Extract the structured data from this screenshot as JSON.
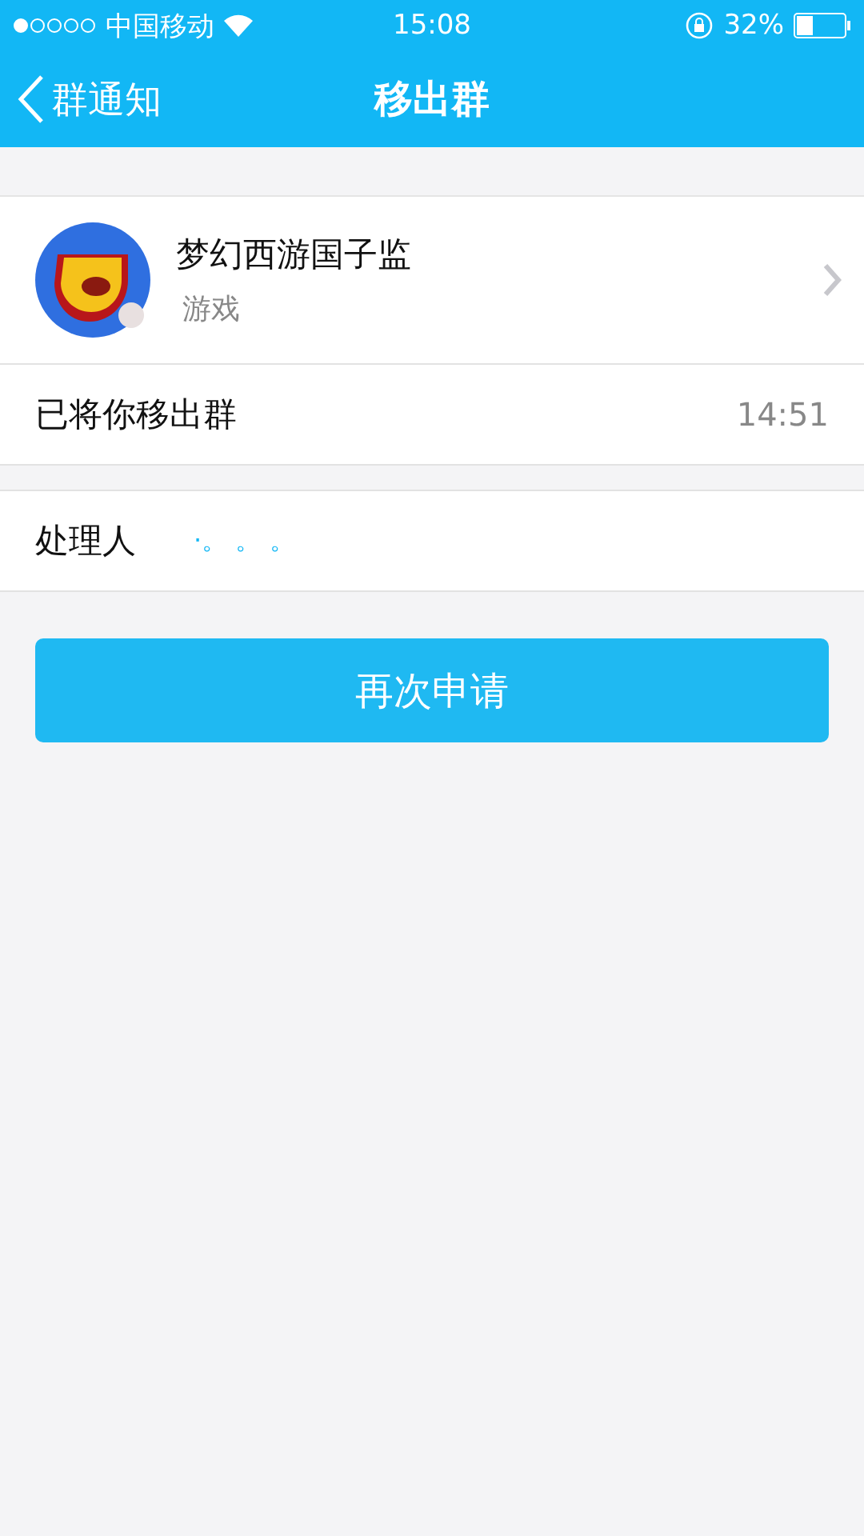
{
  "status_bar": {
    "carrier": "中国移动",
    "time": "15:08",
    "battery": "32%"
  },
  "nav": {
    "back": "群通知",
    "title": "移出群"
  },
  "group": {
    "name": "梦幻西游国子监",
    "category": "游戏"
  },
  "notice": {
    "message": "已将你移出群",
    "time": "14:51"
  },
  "handler": {
    "label": "处理人",
    "value": "·。 。 。"
  },
  "action_button": "再次申请"
}
